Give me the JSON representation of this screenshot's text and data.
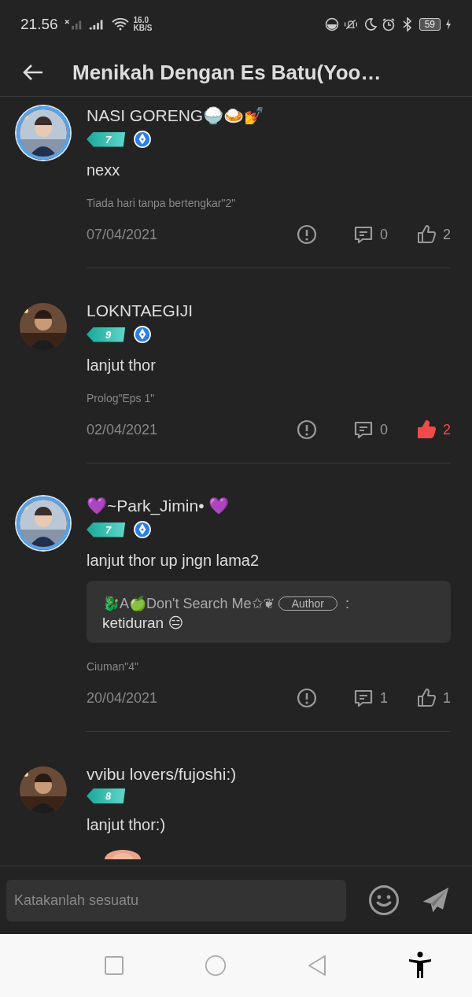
{
  "status_bar": {
    "time": "21.56",
    "speed": "16.0",
    "speed_unit": "KB/S",
    "battery": "59"
  },
  "header": {
    "title": "Menikah Dengan Es Batu(Yoo…"
  },
  "comments": [
    {
      "name": "NASI GORENG🍚🍛💅",
      "framed": true,
      "level": "7",
      "verified": true,
      "text": "nexx",
      "chapter": "Tiada hari tanpa bertengkar\"2\"",
      "date": "07/04/2021",
      "replies": "0",
      "likes": "2",
      "liked": false
    },
    {
      "name": "LOKNTAEGIJI",
      "framed": false,
      "level": "9",
      "verified": true,
      "text": "lanjut thor",
      "chapter": "Prolog\"Eps 1\"",
      "date": "02/04/2021",
      "replies": "0",
      "likes": "2",
      "liked": true
    },
    {
      "name": "💜~Park_Jimin• 💜",
      "framed": true,
      "level": "7",
      "verified": true,
      "text": "lanjut thor up jngn lama2",
      "reply": {
        "author": "🐉A🍏Don't Search Me✩❦",
        "tag": "Author",
        "separator": ":",
        "text": "ketiduran 😑"
      },
      "chapter": "Ciuman\"4\"",
      "date": "20/04/2021",
      "replies": "1",
      "likes": "1",
      "liked": false
    },
    {
      "name": "vvibu lovers/fujoshi:)",
      "framed": false,
      "level": "8",
      "verified": false,
      "text": "lanjut thor:)"
    }
  ],
  "composer": {
    "placeholder": "Katakanlah sesuatu"
  }
}
